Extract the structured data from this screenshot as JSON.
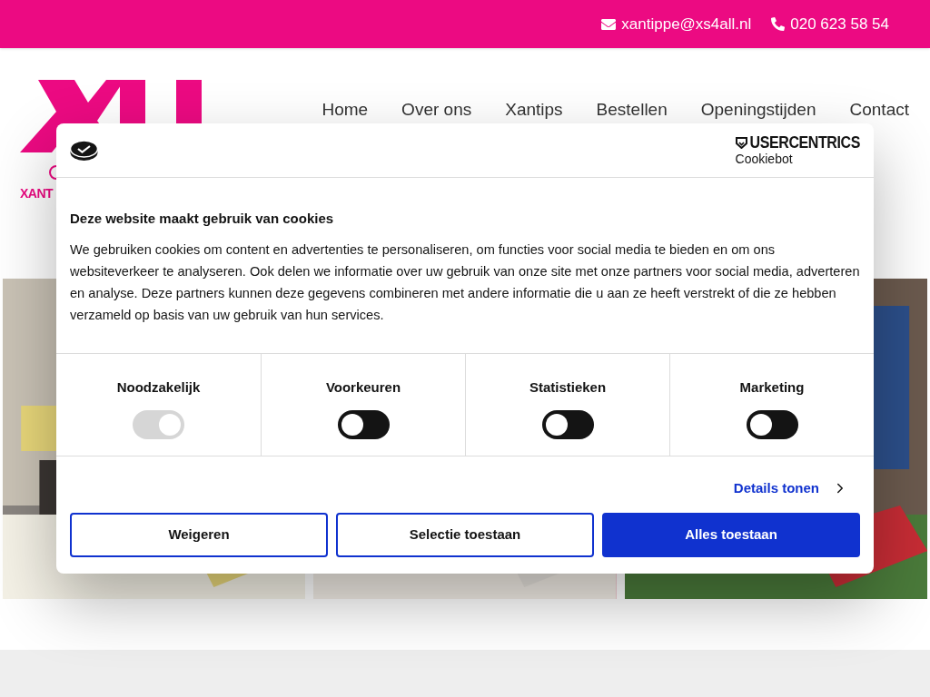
{
  "topbar": {
    "email": "xantippe@xs4all.nl",
    "phone": "020 623 58 54"
  },
  "logo": {
    "tagline": "XANT"
  },
  "nav": [
    {
      "label": "Home"
    },
    {
      "label": "Over ons"
    },
    {
      "label": "Xantips"
    },
    {
      "label": "Bestellen"
    },
    {
      "label": "Openingstijden"
    },
    {
      "label": "Contact"
    }
  ],
  "cookie_dialog": {
    "brand": "USERCENTRICS",
    "product": "Cookiebot",
    "title": "Deze website maakt gebruik van cookies",
    "body": "We gebruiken cookies om content en advertenties te personaliseren, om functies voor social media te bieden en om ons websiteverkeer te analyseren. Ook delen we informatie over uw gebruik van onze site met onze partners voor social media, adverteren en analyse. Deze partners kunnen deze gegevens combineren met andere informatie die u aan ze heeft verstrekt of die ze hebben verzameld op basis van uw gebruik van hun services.",
    "categories": [
      {
        "label": "Noodzakelijk",
        "checked": true,
        "disabled": true
      },
      {
        "label": "Voorkeuren",
        "checked": false,
        "disabled": false
      },
      {
        "label": "Statistieken",
        "checked": false,
        "disabled": false
      },
      {
        "label": "Marketing",
        "checked": false,
        "disabled": false
      }
    ],
    "details_link": "Details tonen",
    "buttons": [
      {
        "label": "Weigeren",
        "kind": "outline"
      },
      {
        "label": "Selectie toestaan",
        "kind": "outline"
      },
      {
        "label": "Alles toestaan",
        "kind": "primary"
      }
    ]
  }
}
